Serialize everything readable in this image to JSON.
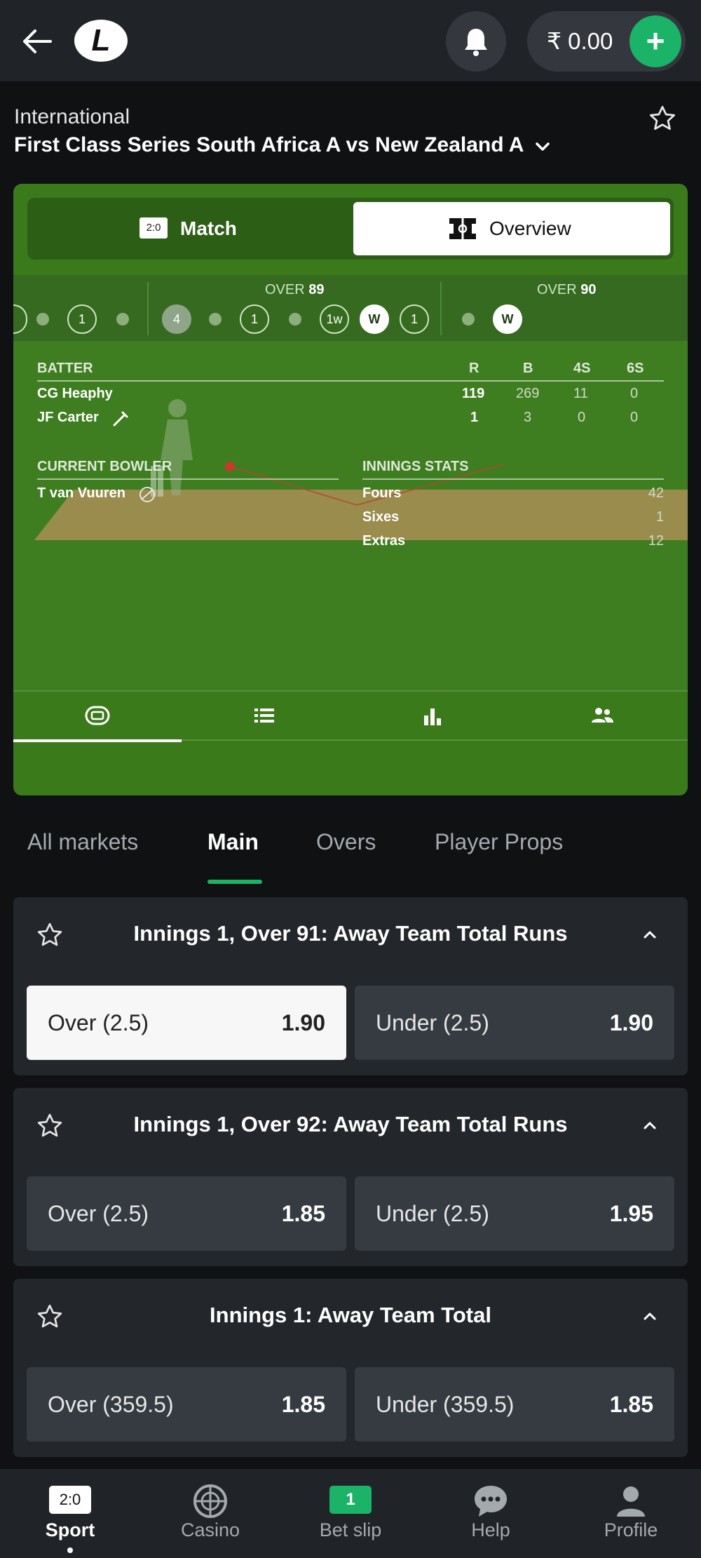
{
  "topbar": {
    "balance": "₹ 0.00",
    "add_label": "+",
    "logo_letter": "L"
  },
  "header": {
    "category": "International",
    "title": "First Class Series South Africa A vs New Zealand A"
  },
  "widget": {
    "toggle": {
      "match_score_icon": "2:0",
      "match_label": "Match",
      "overview_label": "Overview"
    },
    "overs": [
      {
        "label_prefix": "OVER",
        "number": "89"
      },
      {
        "label_prefix": "OVER",
        "number": "90"
      }
    ],
    "balls": {
      "prev": [
        "",
        "•",
        "1",
        "•"
      ],
      "over89": [
        "4",
        "•",
        "1",
        "•",
        "1w",
        "W",
        "1"
      ],
      "over90": [
        "•",
        "W"
      ]
    },
    "batting": {
      "header": "BATTER",
      "cols": [
        "R",
        "B",
        "4S",
        "6S"
      ],
      "rows": [
        {
          "name": "CG Heaphy",
          "r": "119",
          "b": "269",
          "fours": "11",
          "sixes": "0"
        },
        {
          "name": "JF Carter",
          "r": "1",
          "b": "3",
          "fours": "0",
          "sixes": "0"
        }
      ]
    },
    "bowler": {
      "header": "CURRENT BOWLER",
      "name": "T van Vuuren"
    },
    "innings": {
      "header": "INNINGS STATS",
      "rows": [
        {
          "label": "Fours",
          "value": "42"
        },
        {
          "label": "Sixes",
          "value": "1"
        },
        {
          "label": "Extras",
          "value": "12"
        }
      ]
    },
    "tab_icons": [
      "pitch-icon",
      "list-icon",
      "bar-chart-icon",
      "players-icon"
    ]
  },
  "market_tabs": [
    "All markets",
    "Main",
    "Overs",
    "Player Props"
  ],
  "active_market_tab": "Main",
  "markets": [
    {
      "title": "Innings 1, Over 91: Away Team Total Runs",
      "over": {
        "label": "Over (2.5)",
        "odds": "1.90"
      },
      "under": {
        "label": "Under (2.5)",
        "odds": "1.90"
      }
    },
    {
      "title": "Innings 1, Over 92: Away Team Total Runs",
      "over": {
        "label": "Over (2.5)",
        "odds": "1.85"
      },
      "under": {
        "label": "Under (2.5)",
        "odds": "1.95"
      }
    },
    {
      "title": "Innings 1: Away Team Total",
      "over": {
        "label": "Over (359.5)",
        "odds": "1.85"
      },
      "under": {
        "label": "Under (359.5)",
        "odds": "1.85"
      }
    }
  ],
  "bottom_nav": [
    {
      "label": "Sport",
      "icon": "2:0"
    },
    {
      "label": "Casino",
      "icon": "roulette-icon"
    },
    {
      "label": "Bet slip",
      "badge": "1"
    },
    {
      "label": "Help",
      "icon": "chat-icon"
    },
    {
      "label": "Profile",
      "icon": "person-icon"
    }
  ],
  "colors": {
    "accent": "#1bb367",
    "widget_green": "#3b7a1a",
    "card_bg": "#23272c"
  }
}
